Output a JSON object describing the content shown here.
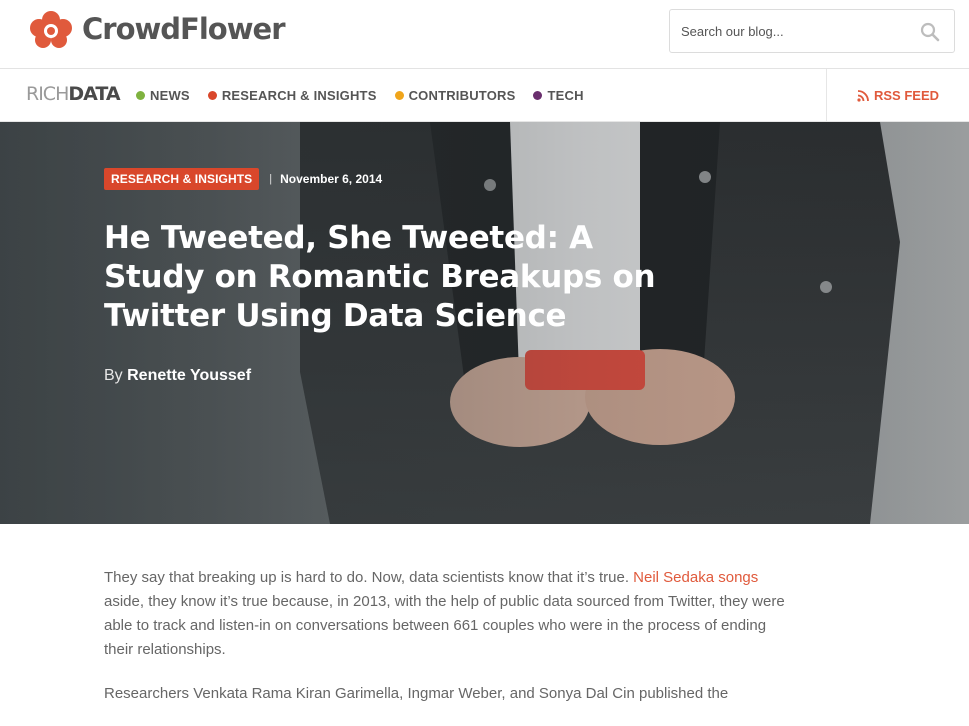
{
  "header": {
    "logo_text": "CrowdFlower",
    "search_placeholder": "Search our blog..."
  },
  "nav": {
    "brand_rich": "RICH",
    "brand_data": "DATA",
    "items": [
      {
        "label": "NEWS",
        "color": "#7fb23f"
      },
      {
        "label": "RESEARCH & INSIGHTS",
        "color": "#d9472b"
      },
      {
        "label": "CONTRIBUTORS",
        "color": "#f0a51b"
      },
      {
        "label": "TECH",
        "color": "#6a2f6e"
      }
    ],
    "rss_label": "RSS FEED",
    "rss_icon": "rss-icon"
  },
  "hero": {
    "category": "RESEARCH & INSIGHTS",
    "separator": "|",
    "date": "November 6, 2014",
    "title": "He Tweeted, She Tweeted: A Study on Romantic Breakups on Twitter Using Data Science",
    "by_prefix": "By",
    "author": "Renette Youssef"
  },
  "article": {
    "p1_before": "They say that breaking up is hard to do. Now, data scientists know that it’s true. ",
    "p1_link": "Neil Sedaka songs",
    "p1_after": " aside, they know it’s true because, in 2013, with the help of public data sourced from Twitter, they were able to track and listen-in on conversations between 661 couples who were in the process of ending their relationships.",
    "p2": "Researchers Venkata Rama Kiran Garimella, Ingmar Weber, and Sonya Dal Cin published the"
  },
  "colors": {
    "accent": "#e05a3c",
    "badge": "#d9472b"
  }
}
